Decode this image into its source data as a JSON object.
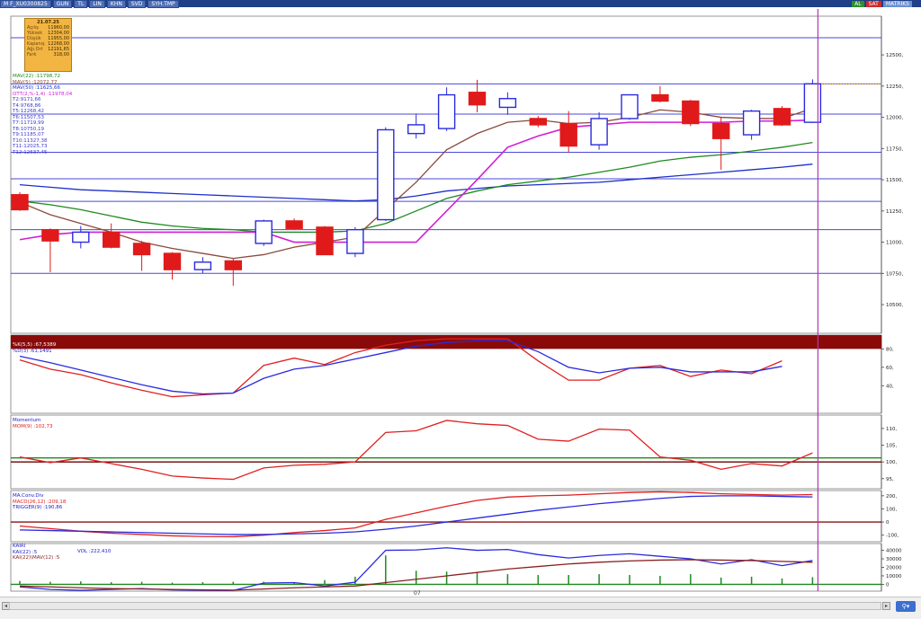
{
  "toolbar": {
    "symbol": "M F_XU0300825",
    "chips": [
      "GUN",
      "TL",
      "LIN",
      "KHN",
      "SVD",
      "SYH.TMP"
    ],
    "badges": [
      {
        "label": "AL",
        "color": "green"
      },
      {
        "label": "SAT",
        "color": "red"
      },
      {
        "label": "MATRIKS",
        "color": "blue"
      },
      {
        "label": "",
        "color": "gray"
      }
    ]
  },
  "info_box": {
    "date": "21.07.25",
    "rows": [
      {
        "k": "Açılış",
        "v": "11960,00"
      },
      {
        "k": "Yüksek",
        "v": "12304,00"
      },
      {
        "k": "Düşük",
        "v": "11955,00"
      },
      {
        "k": "Kapanış",
        "v": "12268,00"
      },
      {
        "k": "Ağı.Ort",
        "v": "12191,65"
      },
      {
        "k": "Fark",
        "v": "318,00"
      }
    ]
  },
  "price_legend": [
    {
      "text": "MAV(22)   :11798,72",
      "color": "#1f8a1f"
    },
    {
      "text": "MAV(5)    :12072,77",
      "color": "#8a4a3a"
    },
    {
      "text": "MAV(50)   :11625,66",
      "color": "#1d2fc8"
    },
    {
      "text": "OTT(2,%-1,4) :11978,04",
      "color": "#d21fd2"
    },
    {
      "text": "T2:9171,66",
      "color": "#3a3ad0"
    },
    {
      "text": "T4:9768,86",
      "color": "#3a3ad0"
    },
    {
      "text": "T5:12268,42",
      "color": "#3a3ad0"
    },
    {
      "text": "T6:11507,53",
      "color": "#3a3ad0"
    },
    {
      "text": "T7:11719,99",
      "color": "#3a3ad0"
    },
    {
      "text": "T8:10750,19",
      "color": "#3a3ad0"
    },
    {
      "text": "T9:11185,07",
      "color": "#3a3ad0"
    },
    {
      "text": "T10:11327,38",
      "color": "#3a3ad0"
    },
    {
      "text": "T11:12025,73",
      "color": "#3a3ad0"
    },
    {
      "text": "T12:12637,45",
      "color": "#3a3ad0"
    }
  ],
  "stoch_legend": [
    {
      "text": "%K(5,5)   :67,5389",
      "color": "#ffffff"
    },
    {
      "text": "%D(3)     :61,1491",
      "color": "#2020d0"
    }
  ],
  "mom_legend": [
    {
      "text": "Momentum",
      "color": "#2020d0"
    },
    {
      "text": "MOM(9)    :102,73",
      "color": "#e02020"
    }
  ],
  "macd_legend": [
    {
      "text": "MA.Conv.Div",
      "color": "#2020d0"
    },
    {
      "text": "MACD(26,12)  :209,18",
      "color": "#e02020"
    },
    {
      "text": "TRIGGER(9)   :190,86",
      "color": "#2020d0"
    }
  ],
  "kairi_legend": [
    {
      "text": "KAIRI",
      "color": "#2020d0"
    },
    {
      "text": "KAI(22)     :5",
      "color": "#2020d0"
    },
    {
      "text": "KAI(22)\\MAV(12)  :5",
      "color": "#8a2020"
    }
  ],
  "vol_legend": {
    "text": "VOL      :222,410",
    "color": "#2020d0"
  },
  "date_label": "07",
  "chart_data": [
    {
      "type": "candlestick",
      "panel": "price",
      "y_ticks": [
        10500,
        10750,
        11000,
        11250,
        11500,
        11750,
        12000,
        12250,
        12500
      ],
      "y_tick_labels": [
        "10500,",
        "10750,",
        "11000,",
        "11250,",
        "11500,",
        "11750,",
        "12000,",
        "12250,",
        "12500,"
      ],
      "ylim": [
        10270,
        12810
      ],
      "h_levels": [
        12637,
        12268,
        12026,
        11720,
        11508,
        11327,
        11100,
        10750
      ],
      "last_price_marker": 12268,
      "candles": [
        {
          "o": 11380,
          "h": 11400,
          "l": 11250,
          "c": 11260
        },
        {
          "o": 11100,
          "h": 11110,
          "l": 10760,
          "c": 11010
        },
        {
          "o": 11000,
          "h": 11130,
          "l": 10950,
          "c": 11080
        },
        {
          "o": 11080,
          "h": 11150,
          "l": 10950,
          "c": 10960
        },
        {
          "o": 10990,
          "h": 11010,
          "l": 10770,
          "c": 10900
        },
        {
          "o": 10910,
          "h": 10920,
          "l": 10700,
          "c": 10780
        },
        {
          "o": 10780,
          "h": 10880,
          "l": 10750,
          "c": 10840
        },
        {
          "o": 10850,
          "h": 10870,
          "l": 10650,
          "c": 10780
        },
        {
          "o": 10990,
          "h": 11180,
          "l": 10970,
          "c": 11170
        },
        {
          "o": 11170,
          "h": 11190,
          "l": 11100,
          "c": 11110
        },
        {
          "o": 11120,
          "h": 11130,
          "l": 10900,
          "c": 10900
        },
        {
          "o": 10910,
          "h": 11120,
          "l": 10880,
          "c": 11100
        },
        {
          "o": 11180,
          "h": 11920,
          "l": 11170,
          "c": 11900
        },
        {
          "o": 11870,
          "h": 12030,
          "l": 11830,
          "c": 11940
        },
        {
          "o": 11910,
          "h": 12240,
          "l": 11890,
          "c": 12180
        },
        {
          "o": 12200,
          "h": 12300,
          "l": 12040,
          "c": 12100
        },
        {
          "o": 12080,
          "h": 12200,
          "l": 12020,
          "c": 12150
        },
        {
          "o": 11990,
          "h": 12010,
          "l": 11920,
          "c": 11940
        },
        {
          "o": 11950,
          "h": 12050,
          "l": 11720,
          "c": 11770
        },
        {
          "o": 11780,
          "h": 12040,
          "l": 11740,
          "c": 11990
        },
        {
          "o": 11990,
          "h": 12180,
          "l": 11980,
          "c": 12180
        },
        {
          "o": 12180,
          "h": 12250,
          "l": 12120,
          "c": 12130
        },
        {
          "o": 12130,
          "h": 12140,
          "l": 11930,
          "c": 11950
        },
        {
          "o": 11950,
          "h": 12000,
          "l": 11580,
          "c": 11830
        },
        {
          "o": 11860,
          "h": 12060,
          "l": 11820,
          "c": 12050
        },
        {
          "o": 12070,
          "h": 12090,
          "l": 11930,
          "c": 11940
        },
        {
          "o": 11960,
          "h": 12304,
          "l": 11955,
          "c": 12268
        }
      ],
      "lines": [
        {
          "name": "MAV(50)",
          "color": "#1d2fc8",
          "values": [
            11460,
            11440,
            11420,
            11410,
            11400,
            11390,
            11380,
            11370,
            11360,
            11350,
            11340,
            11330,
            11340,
            11370,
            11410,
            11430,
            11450,
            11460,
            11470,
            11480,
            11500,
            11520,
            11540,
            11560,
            11580,
            11600,
            11625
          ]
        },
        {
          "name": "MAV(22)",
          "color": "#1f8a1f",
          "values": [
            11330,
            11300,
            11260,
            11210,
            11160,
            11130,
            11110,
            11100,
            11080,
            11080,
            11080,
            11090,
            11150,
            11250,
            11350,
            11410,
            11460,
            11490,
            11520,
            11560,
            11600,
            11650,
            11680,
            11700,
            11730,
            11760,
            11798
          ]
        },
        {
          "name": "MAV(5)",
          "color": "#8a4a3a",
          "values": [
            11320,
            11220,
            11150,
            11080,
            11000,
            10950,
            10910,
            10870,
            10900,
            10960,
            11000,
            11040,
            11260,
            11480,
            11740,
            11870,
            11960,
            11980,
            11950,
            11960,
            12000,
            12060,
            12040,
            12000,
            11990,
            11990,
            12072
          ]
        },
        {
          "name": "OTT",
          "color": "#d21fd2",
          "values": [
            11020,
            11060,
            11080,
            11080,
            11080,
            11080,
            11080,
            11080,
            11080,
            11000,
            11000,
            11000,
            11000,
            11000,
            11250,
            11500,
            11760,
            11850,
            11920,
            11940,
            11960,
            11960,
            11960,
            11960,
            11970,
            11970,
            11978
          ]
        }
      ]
    },
    {
      "type": "line",
      "panel": "stochastic",
      "y_ticks": [
        40,
        60,
        80
      ],
      "y_tick_labels": [
        "40,",
        "60,",
        "80,"
      ],
      "ylim": [
        10,
        95
      ],
      "band": [
        80,
        100
      ],
      "series": [
        {
          "name": "%K(5,5)",
          "color": "#e02020",
          "values": [
            68,
            58,
            52,
            43,
            35,
            28,
            30,
            32,
            62,
            70,
            63,
            76,
            84,
            89,
            91,
            91,
            91,
            67,
            46,
            46,
            59,
            62,
            50,
            57,
            53,
            67
          ]
        },
        {
          "name": "%D(3)",
          "color": "#2a2ae0",
          "values": [
            72,
            65,
            57,
            49,
            41,
            34,
            31,
            32,
            48,
            58,
            62,
            69,
            76,
            83,
            87,
            89,
            89,
            77,
            60,
            54,
            59,
            60,
            55,
            55,
            55,
            61
          ]
        }
      ]
    },
    {
      "type": "line",
      "panel": "momentum",
      "y_ticks": [
        95,
        100,
        105,
        110
      ],
      "y_tick_labels": [
        "95,",
        "100,",
        "105,",
        "110,"
      ],
      "ylim": [
        92,
        114
      ],
      "ref_lines": [
        {
          "value": 100,
          "color": "#6a0000"
        },
        {
          "value": 101.2,
          "color": "#1f8a1f"
        }
      ],
      "series": [
        {
          "name": "MOM(9)",
          "color": "#e02020",
          "values": [
            101.5,
            99.8,
            101.2,
            99.5,
            97.8,
            95.8,
            95.2,
            94.8,
            98.2,
            99.0,
            99.3,
            100.0,
            108.8,
            109.3,
            112.4,
            111.4,
            110.9,
            106.8,
            106.2,
            109.8,
            109.5,
            101.5,
            100.5,
            97.8,
            99.5,
            98.8,
            102.7
          ]
        }
      ]
    },
    {
      "type": "line",
      "panel": "macd",
      "y_ticks": [
        -100,
        0,
        100,
        200
      ],
      "y_tick_labels": [
        "-100,",
        "0",
        "100,",
        "200,"
      ],
      "ylim": [
        -150,
        240
      ],
      "ref_lines": [
        {
          "value": 0,
          "color": "#8a1010"
        }
      ],
      "series": [
        {
          "name": "MACD(26,12)",
          "color": "#e02020",
          "values": [
            -30,
            -50,
            -70,
            -85,
            -95,
            -105,
            -110,
            -112,
            -100,
            -80,
            -65,
            -45,
            20,
            70,
            120,
            165,
            190,
            200,
            205,
            215,
            225,
            230,
            225,
            215,
            210,
            205,
            209
          ]
        },
        {
          "name": "TRIGGER(9)",
          "color": "#2a2ae0",
          "values": [
            -60,
            -65,
            -70,
            -75,
            -80,
            -85,
            -90,
            -95,
            -95,
            -90,
            -85,
            -75,
            -55,
            -30,
            0,
            30,
            60,
            90,
            115,
            140,
            160,
            180,
            195,
            200,
            200,
            195,
            191
          ]
        }
      ]
    },
    {
      "type": "line",
      "panel": "kairi",
      "y_ticks": [
        0,
        10000,
        20000,
        30000,
        40000
      ],
      "y_tick_labels": [
        "0",
        "10000",
        "20000",
        "30000",
        "40000"
      ],
      "ylim": [
        -8000,
        48000
      ],
      "ref_lines": [
        {
          "value": 0,
          "color": "#1f8a1f"
        }
      ],
      "series": [
        {
          "name": "KAI(22)",
          "color": "#2a2ae0",
          "values": [
            -3000,
            -6000,
            -7000,
            -6000,
            -5000,
            -6500,
            -7000,
            -7200,
            1500,
            2000,
            -2000,
            2500,
            40000,
            40500,
            43000,
            40000,
            41000,
            35000,
            31000,
            34000,
            36000,
            33000,
            30000,
            24000,
            29000,
            22000,
            28000
          ]
        },
        {
          "name": "KAI(22)\\MAV(12)",
          "color": "#8a2020",
          "values": [
            -2000,
            -3000,
            -4000,
            -5000,
            -5500,
            -6000,
            -6500,
            -6800,
            -5500,
            -4000,
            -3000,
            -2000,
            2000,
            6000,
            10000,
            14000,
            18000,
            21000,
            24000,
            26000,
            27500,
            28500,
            29000,
            28500,
            28000,
            27000,
            26000
          ]
        }
      ],
      "volume": [
        4000,
        3000,
        3500,
        2500,
        3000,
        2000,
        2500,
        3000,
        3000,
        2500,
        5000,
        9000,
        34000,
        16000,
        15000,
        14000,
        12000,
        11000,
        11000,
        12000,
        11000,
        10000,
        12000,
        8000,
        9000,
        7000,
        8500
      ]
    }
  ]
}
